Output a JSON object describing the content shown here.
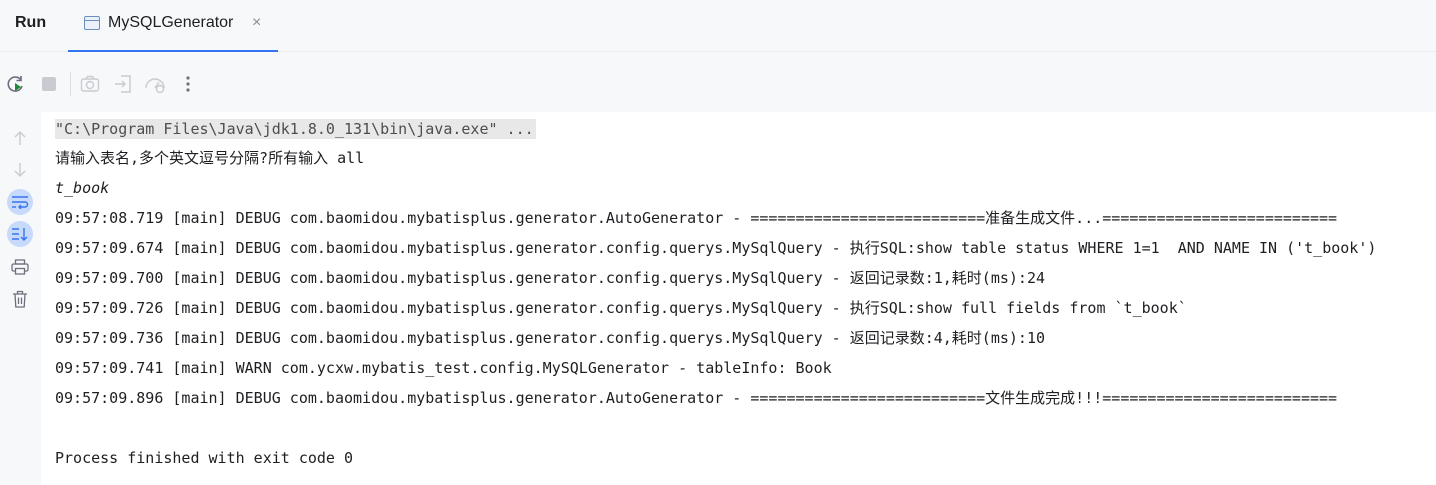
{
  "tabbar": {
    "title": "Run",
    "tab_label": "MySQLGenerator",
    "close_glyph": "×"
  },
  "toolbar": {
    "icons": [
      "rerun-icon",
      "stop-icon",
      "screenshot-icon",
      "exit-icon",
      "profiler-icon",
      "more-icon"
    ]
  },
  "gutter": {
    "icons": [
      "scroll-up-icon",
      "scroll-down-icon",
      "soft-wrap-icon",
      "scroll-to-end-icon",
      "print-icon",
      "clear-icon"
    ]
  },
  "console": {
    "command": "\"C:\\Program Files\\Java\\jdk1.8.0_131\\bin\\java.exe\" ...",
    "lines": [
      "请输入表名,多个英文逗号分隔?所有输入 all",
      "t_book",
      "09:57:08.719 [main] DEBUG com.baomidou.mybatisplus.generator.AutoGenerator - ==========================准备生成文件...==========================",
      "09:57:09.674 [main] DEBUG com.baomidou.mybatisplus.generator.config.querys.MySqlQuery - 执行SQL:show table status WHERE 1=1  AND NAME IN ('t_book')",
      "09:57:09.700 [main] DEBUG com.baomidou.mybatisplus.generator.config.querys.MySqlQuery - 返回记录数:1,耗时(ms):24",
      "09:57:09.726 [main] DEBUG com.baomidou.mybatisplus.generator.config.querys.MySqlQuery - 执行SQL:show full fields from `t_book`",
      "09:57:09.736 [main] DEBUG com.baomidou.mybatisplus.generator.config.querys.MySqlQuery - 返回记录数:4,耗时(ms):10",
      "09:57:09.741 [main] WARN com.ycxw.mybatis_test.config.MySQLGenerator - tableInfo: Book",
      "09:57:09.896 [main] DEBUG com.baomidou.mybatisplus.generator.AutoGenerator - ==========================文件生成完成!!!=========================="
    ],
    "exit_message": "Process finished with exit code 0"
  },
  "colors": {
    "accent": "#3574f0",
    "active_button_bg": "#c8dafc",
    "command_highlight": "#e8e8e8"
  }
}
